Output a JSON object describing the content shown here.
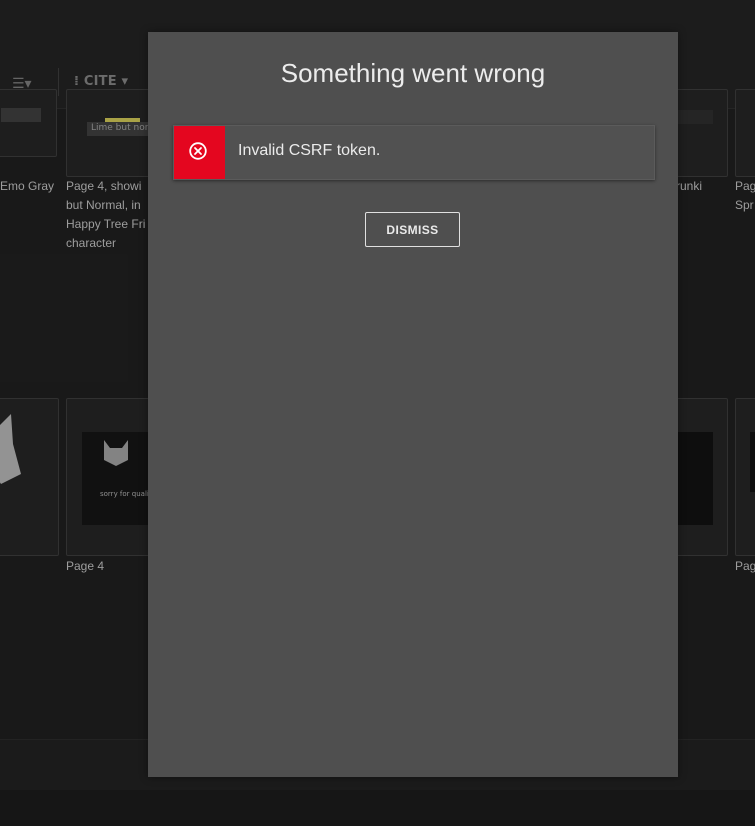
{
  "toolbar": {
    "cite_label": "CITE"
  },
  "gallery": {
    "row1_captions": [
      {
        "id": "c1",
        "text": "Emo Gray"
      },
      {
        "id": "c2",
        "text": "Page 4, showi\nbut Normal, in\nHappy Tree Fri\ncharacter"
      },
      {
        "id": "c3",
        "text": "runki"
      },
      {
        "id": "c4",
        "text": "Pag\nSpr"
      }
    ],
    "row2_captions": [
      {
        "id": "c5",
        "text": "Page 4"
      },
      {
        "id": "c6",
        "text": "Pag"
      }
    ],
    "thumb_text_1": "Lime but norr",
    "thumb_text_2": "sorry for quality"
  },
  "modal": {
    "title": "Something went wrong",
    "alert_message": "Invalid CSRF token.",
    "dismiss_label": "DISMISS"
  },
  "colors": {
    "error_red": "#e4061f",
    "modal_bg": "#4f4f4f"
  },
  "icons": {
    "alert": "error-circle-x-icon",
    "list": "indent-list-icon",
    "cite": "cite-icon"
  }
}
